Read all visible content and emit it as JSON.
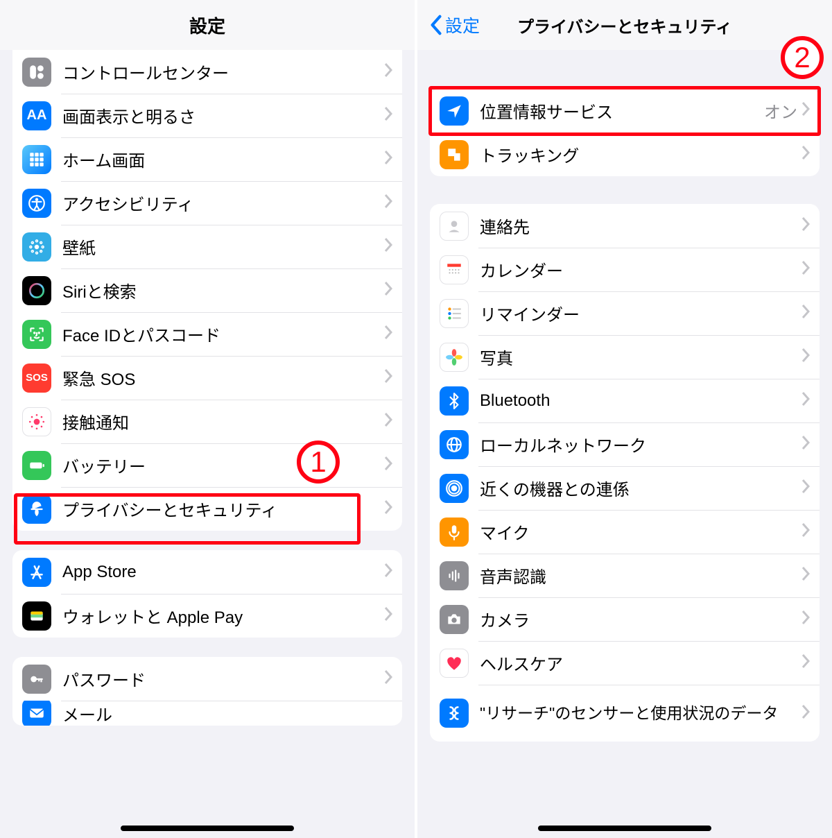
{
  "annotations": {
    "step1": "1",
    "step2": "2"
  },
  "left": {
    "title": "設定",
    "groups": [
      {
        "id": "general",
        "rows": [
          {
            "id": "control-center",
            "label": "コントロールセンター",
            "icon": "control-center-icon"
          },
          {
            "id": "display",
            "label": "画面表示と明るさ",
            "icon": "display-icon"
          },
          {
            "id": "home-screen",
            "label": "ホーム画面",
            "icon": "home-screen-icon"
          },
          {
            "id": "accessibility",
            "label": "アクセシビリティ",
            "icon": "accessibility-icon"
          },
          {
            "id": "wallpaper",
            "label": "壁紙",
            "icon": "wallpaper-icon"
          },
          {
            "id": "siri",
            "label": "Siriと検索",
            "icon": "siri-icon"
          },
          {
            "id": "faceid",
            "label": "Face IDとパスコード",
            "icon": "faceid-icon"
          },
          {
            "id": "sos",
            "label": "緊急 SOS",
            "icon": "sos-icon"
          },
          {
            "id": "exposure",
            "label": "接触通知",
            "icon": "exposure-icon"
          },
          {
            "id": "battery",
            "label": "バッテリー",
            "icon": "battery-icon"
          },
          {
            "id": "privacy",
            "label": "プライバシーとセキュリティ",
            "icon": "privacy-icon"
          }
        ]
      },
      {
        "id": "store",
        "rows": [
          {
            "id": "appstore",
            "label": "App Store",
            "icon": "appstore-icon"
          },
          {
            "id": "wallet",
            "label": "ウォレットと Apple Pay",
            "icon": "wallet-icon"
          }
        ]
      },
      {
        "id": "accounts",
        "rows": [
          {
            "id": "passwords",
            "label": "パスワード",
            "icon": "passwords-icon"
          },
          {
            "id": "mail",
            "label": "メール",
            "icon": "mail-icon"
          }
        ]
      }
    ]
  },
  "right": {
    "back": "設定",
    "title": "プライバシーとセキュリティ",
    "groups": [
      {
        "id": "location",
        "rows": [
          {
            "id": "location",
            "label": "位置情報サービス",
            "icon": "location-icon",
            "value": "オン"
          },
          {
            "id": "tracking",
            "label": "トラッキング",
            "icon": "tracking-icon"
          }
        ]
      },
      {
        "id": "data",
        "rows": [
          {
            "id": "contacts",
            "label": "連絡先",
            "icon": "contacts-icon"
          },
          {
            "id": "calendar",
            "label": "カレンダー",
            "icon": "calendar-icon"
          },
          {
            "id": "reminders",
            "label": "リマインダー",
            "icon": "reminders-icon"
          },
          {
            "id": "photos",
            "label": "写真",
            "icon": "photos-icon"
          },
          {
            "id": "bluetooth",
            "label": "Bluetooth",
            "icon": "bluetooth-icon"
          },
          {
            "id": "localnet",
            "label": "ローカルネットワーク",
            "icon": "localnet-icon"
          },
          {
            "id": "nearby",
            "label": "近くの機器との連係",
            "icon": "nearby-icon"
          },
          {
            "id": "microphone",
            "label": "マイク",
            "icon": "microphone-icon"
          },
          {
            "id": "speech",
            "label": "音声認識",
            "icon": "speech-icon"
          },
          {
            "id": "camera",
            "label": "カメラ",
            "icon": "camera-icon"
          },
          {
            "id": "health",
            "label": "ヘルスケア",
            "icon": "health-icon"
          },
          {
            "id": "research",
            "label": "\"リサーチ\"のセンサーと使用状況のデータ",
            "icon": "research-icon"
          }
        ]
      }
    ]
  }
}
